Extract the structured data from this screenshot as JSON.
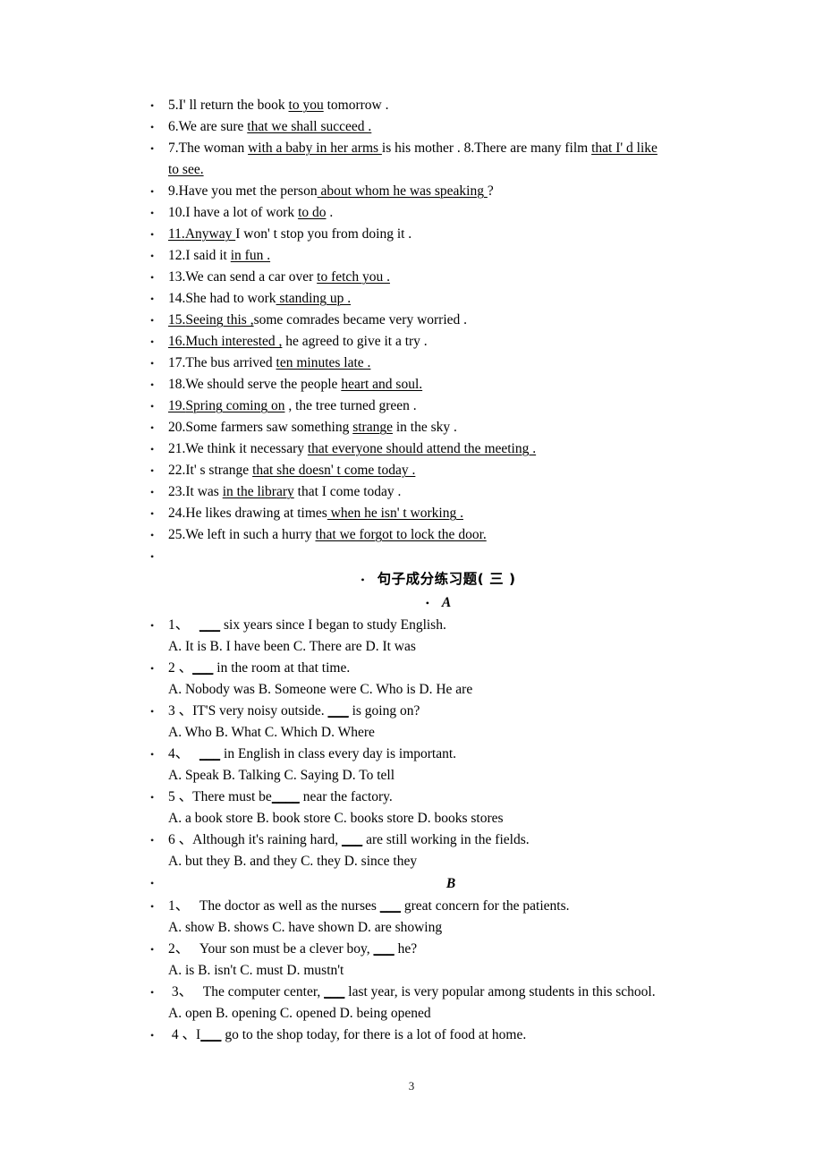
{
  "document": {
    "page_number": "3",
    "bullet_glyph": "•"
  },
  "analysis_items": [
    {
      "number": "5.",
      "parts": [
        {
          "t": "I'  ll return the book ",
          "u": false
        },
        {
          "t": "to you",
          "u": true
        },
        {
          "t": " tomorrow .",
          "u": false
        }
      ]
    },
    {
      "number": "6.",
      "parts": [
        {
          "t": "We are sure ",
          "u": false
        },
        {
          "t": "that we shall succeed .",
          "u": true
        }
      ]
    },
    {
      "number": "7.",
      "parts": [
        {
          "t": "The woman ",
          "u": false
        },
        {
          "t": "with a baby in her arms ",
          "u": true
        },
        {
          "t": "is his mother . 8.There are many film ",
          "u": false
        },
        {
          "t": "that I'  d like",
          "u": true
        }
      ],
      "continuation": [
        {
          "t": "to see.",
          "u": true
        }
      ]
    },
    {
      "number": "9.",
      "parts": [
        {
          "t": "Have you met the person",
          "u": false
        },
        {
          "t": " about whom he was speaking ",
          "u": true
        },
        {
          "t": "?",
          "u": false
        }
      ]
    },
    {
      "number": "10.",
      "parts": [
        {
          "t": "I have a lot of work ",
          "u": false
        },
        {
          "t": "to do",
          "u": true
        },
        {
          "t": " .",
          "u": false
        }
      ]
    },
    {
      "number": "11.",
      "number_underlined": true,
      "parts": [
        {
          "t": "Anyway ",
          "u": true
        },
        {
          "t": "I won'  t stop you from doing it .",
          "u": false
        }
      ]
    },
    {
      "number": "12.",
      "parts": [
        {
          "t": "I said it ",
          "u": false
        },
        {
          "t": "in fun .",
          "u": true
        }
      ]
    },
    {
      "number": "13.",
      "parts": [
        {
          "t": "We can send a car over ",
          "u": false
        },
        {
          "t": "to fetch you .",
          "u": true
        }
      ]
    },
    {
      "number": "14.",
      "parts": [
        {
          "t": "She had to work",
          "u": false
        },
        {
          "t": " standing up .",
          "u": true
        }
      ]
    },
    {
      "number": "15.",
      "number_underlined": true,
      "parts": [
        {
          "t": "Seeing this ,",
          "u": true
        },
        {
          "t": "some comrades became very worried .",
          "u": false
        }
      ]
    },
    {
      "number": "16.",
      "number_underlined": true,
      "parts": [
        {
          "t": "Much interested ,",
          "u": true
        },
        {
          "t": " he agreed to give it a try .",
          "u": false
        }
      ]
    },
    {
      "number": "17.",
      "parts": [
        {
          "t": "The bus arrived ",
          "u": false
        },
        {
          "t": "ten minutes late .",
          "u": true
        }
      ]
    },
    {
      "number": "18.",
      "parts": [
        {
          "t": "We should serve the people ",
          "u": false
        },
        {
          "t": "heart and soul.",
          "u": true
        }
      ]
    },
    {
      "number": "19.",
      "number_underlined": true,
      "parts": [
        {
          "t": "Spring coming on",
          "u": true
        },
        {
          "t": " , the tree turned green .",
          "u": false
        }
      ]
    },
    {
      "number": "20.",
      "parts": [
        {
          "t": "Some farmers saw something ",
          "u": false
        },
        {
          "t": "strange",
          "u": true
        },
        {
          "t": " in the sky .",
          "u": false
        }
      ]
    },
    {
      "number": "21.",
      "parts": [
        {
          "t": "We think it necessary ",
          "u": false
        },
        {
          "t": "that everyone should attend the meeting .",
          "u": true
        }
      ]
    },
    {
      "number": "22.",
      "parts": [
        {
          "t": "It'  s strange ",
          "u": false
        },
        {
          "t": "that she doesn'  t come today .",
          "u": true
        }
      ]
    },
    {
      "number": "23.",
      "parts": [
        {
          "t": "It was ",
          "u": false
        },
        {
          "t": "in the library",
          "u": true
        },
        {
          "t": " that I come today .",
          "u": false
        }
      ]
    },
    {
      "number": "24.",
      "parts": [
        {
          "t": "He likes drawing at times",
          "u": false
        },
        {
          "t": " when he isn'  t working .",
          "u": true
        }
      ]
    },
    {
      "number": "25.",
      "parts": [
        {
          "t": "We left in such a hurry ",
          "u": false
        },
        {
          "t": "that we forgot to lock the door.",
          "u": true
        }
      ]
    }
  ],
  "empty_bullet_line": "",
  "exercise_title": "句子成分练习题( 三 )",
  "sections": [
    {
      "label": "A",
      "questions": [
        {
          "number": "1、",
          "stem_before": "   ",
          "blank": "___",
          "stem_after": " six years since I began to study English.",
          "options": "A. It is B. I have been C. There are D. It was"
        },
        {
          "number": "2 、",
          "stem_before": "",
          "blank": "___",
          "stem_after": " in the room at that time.",
          "options": "A. Nobody was B. Someone were C. Who is D. He are"
        },
        {
          "number": "3 、",
          "stem_before": "IT'S very noisy outside. ",
          "blank": "___",
          "stem_after": " is going on?",
          "options": "A. Who B. What C. Which D. Where"
        },
        {
          "number": "4、",
          "stem_before": "   ",
          "blank": "___",
          "stem_after": " in English in class every day is important.",
          "options": "A. Speak B. Talking C. Saying D. To tell"
        },
        {
          "number": "5 、",
          "stem_before": "There must be",
          "blank": "____",
          "stem_after": " near the factory.",
          "options": "A. a book store B. book store C. books store D. books stores"
        },
        {
          "number": "6 、",
          "stem_before": "Although it's raining hard, ",
          "blank": "___",
          "stem_after": " are still working in the fields.",
          "options": "A. but they B. and they C. they D. since they"
        }
      ]
    },
    {
      "label": "B",
      "questions": [
        {
          "number": "1、",
          "stem_before": "   The doctor as well as the nurses ",
          "blank": "___",
          "stem_after": " great concern for the patients.",
          "options": "A. show B. shows C. have shown D. are showing"
        },
        {
          "number": "2、",
          "stem_before": "   Your son must be a clever boy, ",
          "blank": "___",
          "stem_after": " he?",
          "options": "A. is B. isn't C. must D. mustn't"
        },
        {
          "number": " 3、",
          "stem_before": "   The computer center, ",
          "blank": "___",
          "stem_after": " last year, is very popular among students in   this school.",
          "options": "A. open B. opening    C. opened D. being opened"
        },
        {
          "number": " 4 、",
          "stem_before": "I",
          "blank": "___",
          "stem_after": " go to the shop today, for there is a lot of food at home.",
          "options": ""
        }
      ]
    }
  ]
}
